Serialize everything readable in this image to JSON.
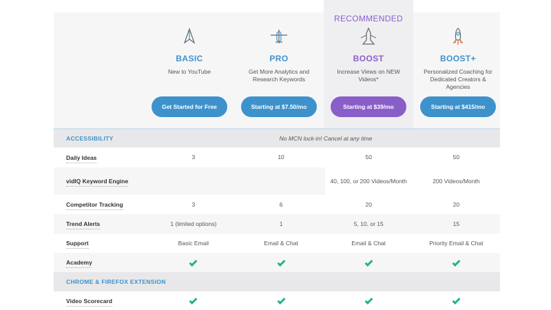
{
  "recommended_label": "RECOMMENDED",
  "plans": [
    {
      "name": "BASIC",
      "desc": "New to YouTube",
      "cta": "Get Started for Free",
      "icon": "paper-plane-icon"
    },
    {
      "name": "PRO",
      "desc": "Get More Analytics and Research Keywords",
      "cta": "Starting at $7.50/mo",
      "icon": "airplane-icon"
    },
    {
      "name": "BOOST",
      "desc": "Increase Views on NEW Videos*",
      "cta": "Starting at $39/mo",
      "icon": "jet-icon"
    },
    {
      "name": "BOOST+",
      "desc": "Personalized Coaching for Dedicated Creators & Agencies",
      "cta": "Starting at $415/mo",
      "icon": "rocket-icon"
    }
  ],
  "colors": {
    "blue": "#3e92cc",
    "purple": "#8a5ec9",
    "check": "#1fb48c"
  },
  "sections": {
    "accessibility": {
      "label": "ACCESSIBILITY",
      "note": "No MCN lock-in! Cancel at any time"
    },
    "extension": {
      "label": "CHROME & FIREFOX EXTENSION"
    }
  },
  "rows": {
    "daily_ideas": {
      "label": "Daily Ideas",
      "values": [
        "3",
        "10",
        "50",
        "50"
      ]
    },
    "keyword_engine": {
      "label": "vidIQ Keyword Engine",
      "values": [
        "",
        "",
        "40, 100, or 200 Videos/Month",
        "200 Videos/Month"
      ]
    },
    "competitor": {
      "label": "Competitor Tracking",
      "values": [
        "3",
        "6",
        "20",
        "20"
      ]
    },
    "trend_alerts": {
      "label": "Trend Alerts",
      "values": [
        "1 (limited options)",
        "1",
        "5, 10, or 15",
        "15"
      ]
    },
    "support": {
      "label": "Support",
      "values": [
        "Basic Email",
        "Email & Chat",
        "Email & Chat",
        "Priority Email & Chat"
      ]
    },
    "academy": {
      "label": "Academy"
    },
    "scorecard": {
      "label": "Video Scorecard"
    }
  }
}
